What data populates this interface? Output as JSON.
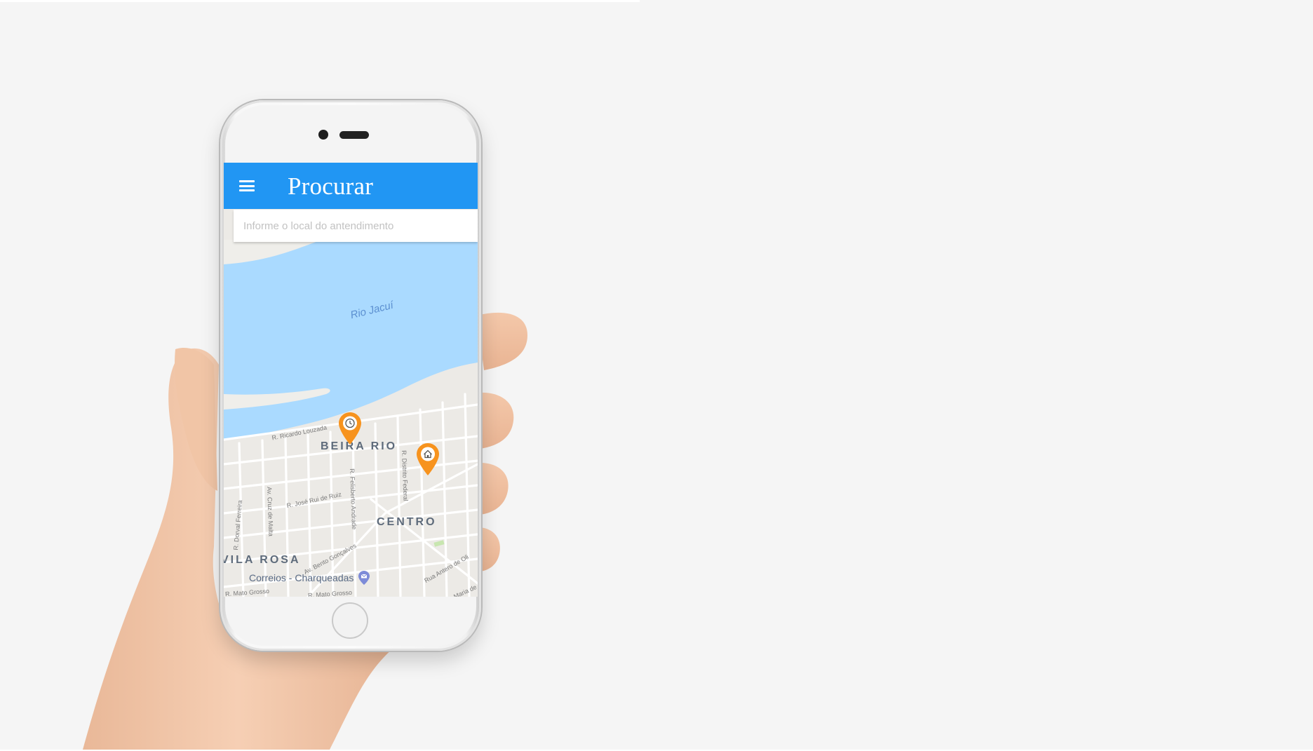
{
  "app": {
    "title": "Procurar",
    "menu_icon": "hamburger-menu-icon"
  },
  "search": {
    "value": "",
    "placeholder": "Informe o local do antendimento"
  },
  "map": {
    "river_label": "Rio Jacuí",
    "neighborhoods": [
      "BEIRA RIO",
      "CENTRO",
      "VILA ROSA"
    ],
    "streets": [
      "R. Ricardo Louzada",
      "Av. Cruz de Malta",
      "R. Felisberto Andrade",
      "R. Distrito Federal",
      "R. José Rui de Ruiz",
      "R. Dorval Ferreira",
      "Av. Bento Gonçalves",
      "Rua Antero de Oli",
      "R. Mato Grosso",
      "R. Mato Grosso",
      "Maria de Ca"
    ],
    "poi": {
      "label": "Correios - Charqueadas",
      "icon": "mail-icon"
    },
    "markers": [
      {
        "name": "clock-marker",
        "icon": "clock-icon"
      },
      {
        "name": "home-marker",
        "icon": "home-icon"
      }
    ]
  },
  "colors": {
    "appbar": "#2196f3",
    "water": "#aadaff",
    "land": "#eceae6",
    "marker": "#f7931e"
  }
}
